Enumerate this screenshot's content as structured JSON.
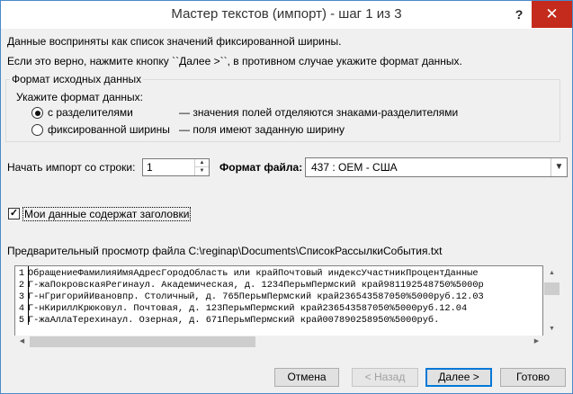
{
  "window": {
    "title": "Мастер текстов (импорт) - шаг 1 из 3",
    "help_label": "?",
    "close_label": "✕"
  },
  "intro": {
    "line1": "Данные восприняты как список значений фиксированной ширины.",
    "line2": "Если это верно, нажмите кнопку ``Далее >``, в противном случае укажите формат данных."
  },
  "source_format": {
    "group_title": "Формат исходных данных",
    "prompt": "Укажите формат данных:",
    "options": [
      {
        "label": "с разделителями",
        "description": "— значения полей отделяются знаками-разделителями",
        "selected": true
      },
      {
        "label": "фиксированной ширины",
        "description": "— поля имеют заданную ширину",
        "selected": false
      }
    ]
  },
  "start_row": {
    "label": "Начать импорт со строки:",
    "value": "1"
  },
  "file_format": {
    "label": "Формат файла:",
    "value": "437 : OEM - США"
  },
  "headers_checkbox": {
    "label": "Мои данные содержат заголовки",
    "checked": true,
    "check_glyph": "✓"
  },
  "preview": {
    "label": "Предварительный просмотр файла C:\\reginap\\Documents\\СписокРассылкиСобытия.txt",
    "rows": [
      {
        "num": "1",
        "text": "ОбращениеФамилияИмяАдресГородОбласть или крайПочтовый индексУчастникПроцентДанные"
      },
      {
        "num": "2",
        "text": "Г-жаПокровскаяРегинаул. Академическая, д. 1234ПерьмПермский край981192548750%5000р"
      },
      {
        "num": "3",
        "text": "Г-нГригорийИвановпр. Столичный, д. 765ПерьмПермский край236543587050%5000руб.12.03"
      },
      {
        "num": "4",
        "text": "Г-нКириллКрюковул. Почтовая, д. 123ПерьмПермский край236543587050%5000руб.12.04"
      },
      {
        "num": "5",
        "text": "Г-жаАллаТерехинаул. Озерная, д. 671ПерьмПермский край007890258950%5000руб."
      }
    ]
  },
  "buttons": {
    "cancel": "Отмена",
    "back": "< Назад",
    "next": "Далее >",
    "finish": "Готово"
  }
}
